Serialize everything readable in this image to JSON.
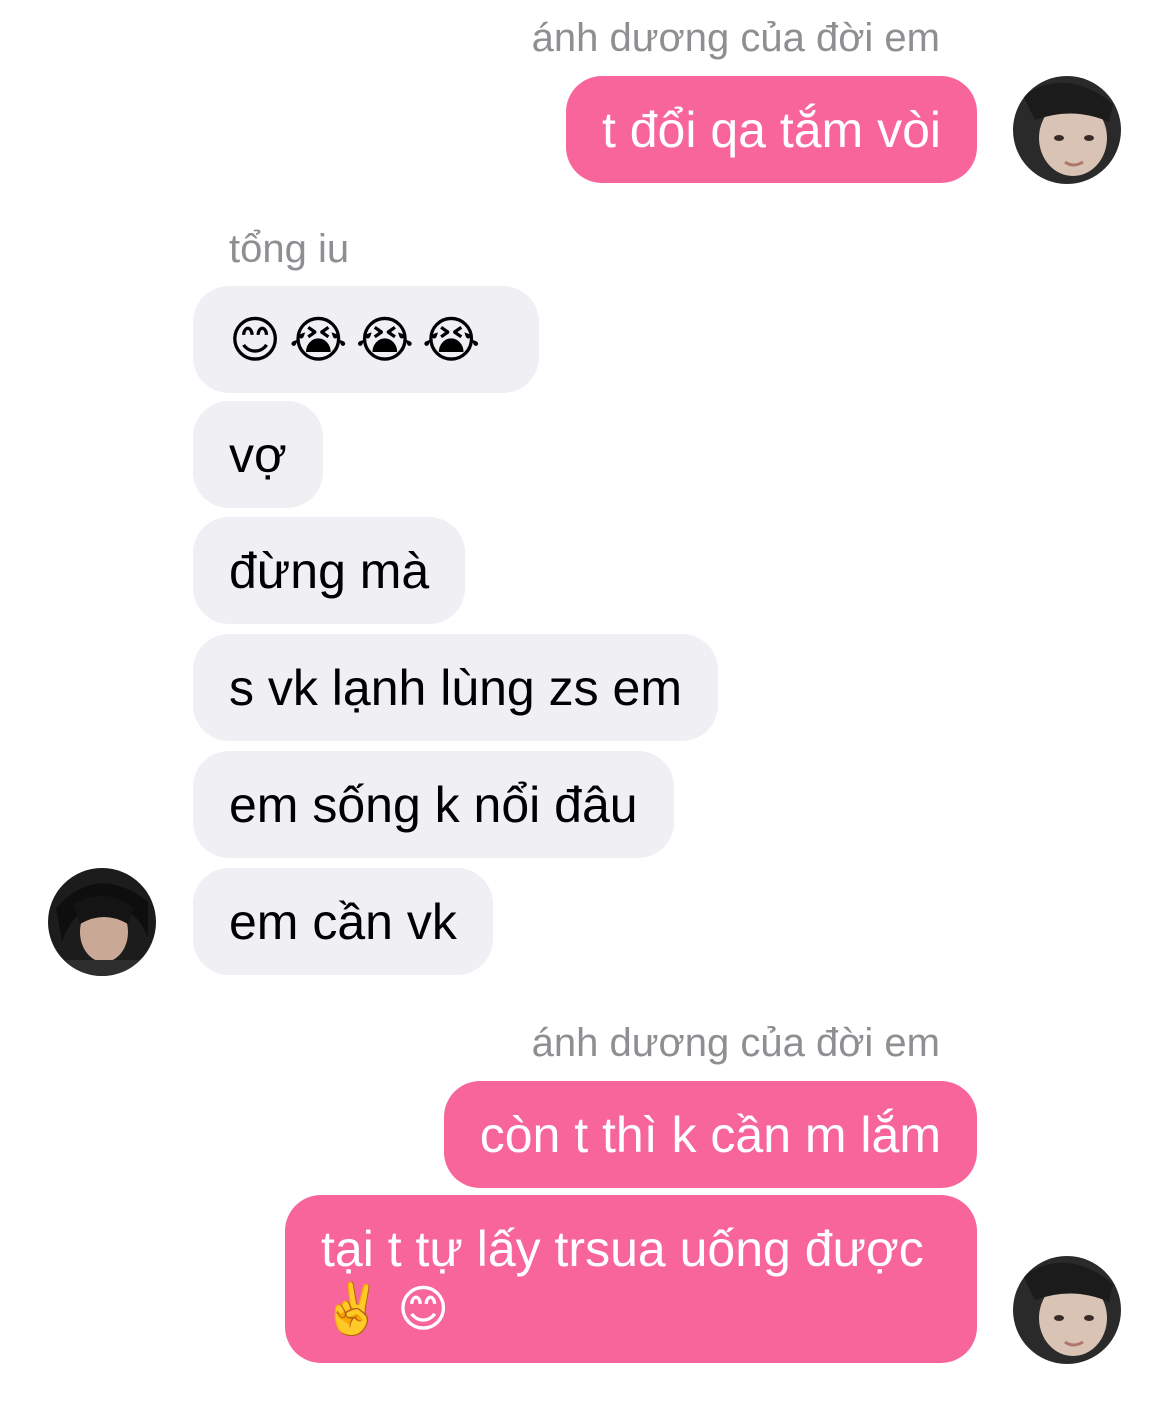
{
  "conversation": {
    "group1": {
      "sender": "ánh dương của đời em",
      "messages": [
        "t đổi qa tắm vòi"
      ]
    },
    "group2": {
      "sender": "tổng iu",
      "emoji_message": [
        "😊",
        "😭",
        "😭",
        "😭"
      ],
      "messages": [
        "vợ",
        "đừng mà",
        "s vk lạnh lùng zs em",
        "em sống k nổi đâu",
        "em cần vk"
      ]
    },
    "group3": {
      "sender": "ánh dương của đời em",
      "messages": [
        "còn t thì k cần m lắm",
        "tại t tự lấy trsua uống được ✌️ 😊"
      ]
    }
  },
  "colors": {
    "outgoing_bubble": "#f7659a",
    "incoming_bubble": "#efeff4",
    "sender_name": "#8e8e93"
  }
}
